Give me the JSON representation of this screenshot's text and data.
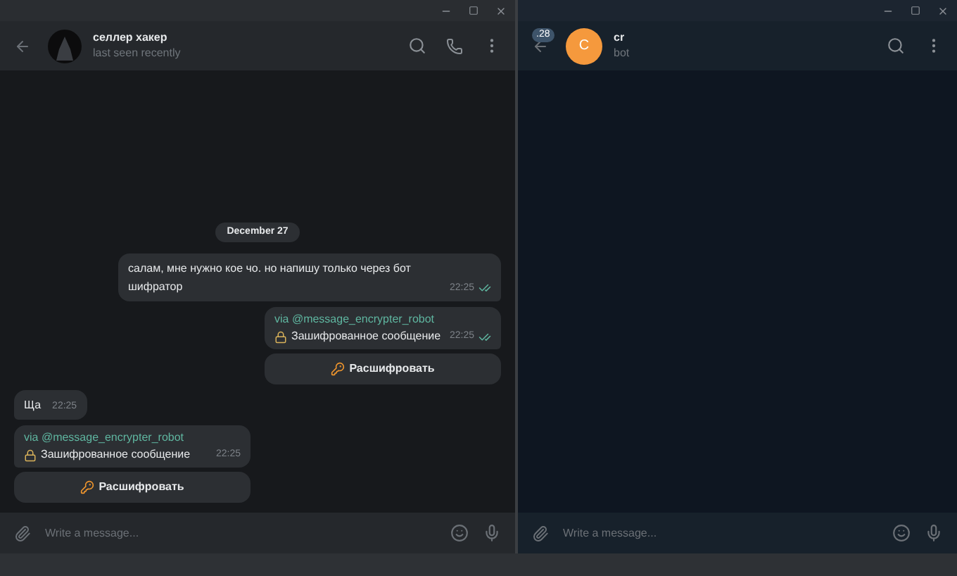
{
  "windows": [
    {
      "kind": "grey",
      "header": {
        "name": "селлер хакер",
        "status": "last seen recently",
        "avatar": {
          "kind": "figure"
        },
        "actions": [
          {
            "kind": "search"
          },
          {
            "kind": "call"
          },
          {
            "kind": "menu"
          }
        ]
      },
      "date": "December 27",
      "messages": [
        {
          "kind": "text",
          "outgoing": true,
          "text": "салам, мне нужно кое чо. но напишу только через бот шифратор",
          "time": "22:25",
          "read": true
        },
        {
          "kind": "inline",
          "outgoing": true,
          "via": "via @message_encrypter_robot",
          "text": "Зашифрованное сообщение",
          "time": "22:25",
          "read": true,
          "button": "Расшифровать"
        },
        {
          "kind": "text",
          "outgoing": false,
          "text": "Ща",
          "time": "22:25",
          "read": false
        },
        {
          "kind": "inline",
          "outgoing": false,
          "via": "via @message_encrypter_robot",
          "text": "Зашифрованное сообщение",
          "time": "22:25",
          "read": false,
          "button": "Расшифровать"
        }
      ],
      "composer": {
        "placeholder": "Write a message..."
      }
    },
    {
      "kind": "navy",
      "header": {
        "name": "cr",
        "status": "bot",
        "badge": ".28",
        "avatar": {
          "kind": "letter",
          "letter": "C",
          "color": "#f5993d"
        },
        "actions": [
          {
            "kind": "search"
          },
          {
            "kind": "menu"
          }
        ]
      },
      "composer": {
        "placeholder": "Write a message..."
      }
    }
  ]
}
